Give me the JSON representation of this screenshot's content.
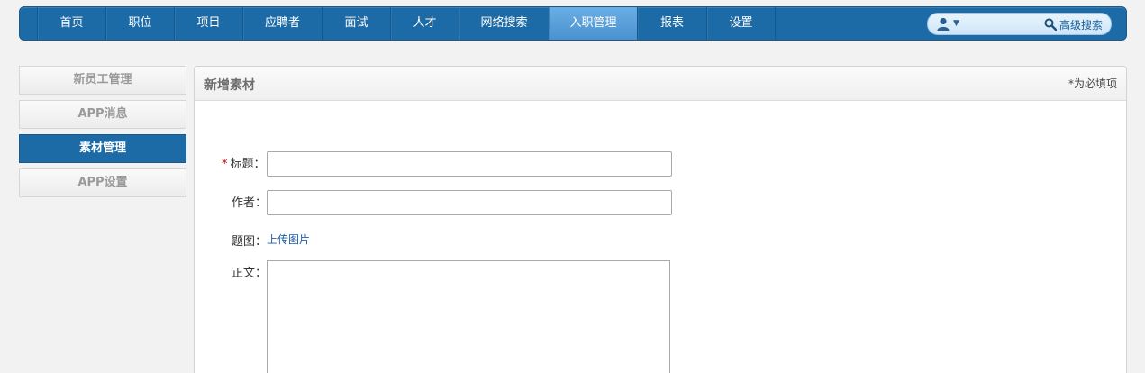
{
  "nav": {
    "items": [
      {
        "label": "首页"
      },
      {
        "label": "职位"
      },
      {
        "label": "项目"
      },
      {
        "label": "应聘者"
      },
      {
        "label": "面试"
      },
      {
        "label": "人才"
      },
      {
        "label": "网络搜索"
      },
      {
        "label": "入职管理"
      },
      {
        "label": "报表"
      },
      {
        "label": "设置"
      }
    ],
    "active": "入职管理",
    "search": {
      "advanced_label": "高级搜索"
    }
  },
  "sidebar": {
    "items": [
      {
        "label": "新员工管理"
      },
      {
        "label": "APP消息"
      },
      {
        "label": "素材管理"
      },
      {
        "label": "APP设置"
      }
    ],
    "active": "素材管理"
  },
  "panel": {
    "title": "新增素材",
    "required_note": "*为必填项",
    "form": {
      "title_label": "标题：",
      "title_required_mark": "*",
      "title_value": "",
      "author_label": "作者：",
      "author_value": "",
      "cover_label": "题图：",
      "upload_label": "上传图片",
      "body_label": "正文：",
      "body_value": ""
    }
  },
  "colors": {
    "nav_bg": "#1c6aa6",
    "nav_active": "#5aa0da",
    "link": "#1e5fa8",
    "required": "#d40000"
  }
}
